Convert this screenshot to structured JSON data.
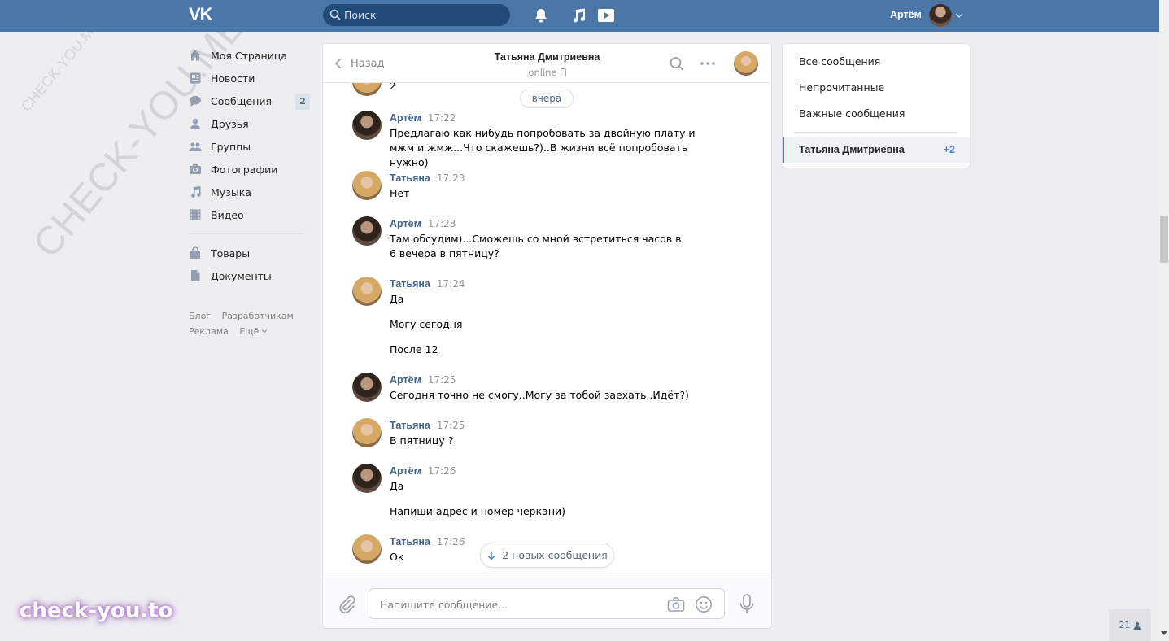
{
  "header": {
    "logo_text": "VK",
    "search_placeholder": "Поиск",
    "user_name": "Артём"
  },
  "sidebar": {
    "items": [
      {
        "label": "Моя Страница",
        "icon": "home-icon"
      },
      {
        "label": "Новости",
        "icon": "news-icon"
      },
      {
        "label": "Сообщения",
        "icon": "messages-icon",
        "badge": "2"
      },
      {
        "label": "Друзья",
        "icon": "friend-icon"
      },
      {
        "label": "Группы",
        "icon": "groups-icon"
      },
      {
        "label": "Фотографии",
        "icon": "camera-icon"
      },
      {
        "label": "Музыка",
        "icon": "music-icon"
      },
      {
        "label": "Видео",
        "icon": "video-icon"
      },
      {
        "label": "Товары",
        "icon": "bag-icon"
      },
      {
        "label": "Документы",
        "icon": "document-icon"
      }
    ],
    "footer": {
      "blog": "Блог",
      "developers": "Разработчикам",
      "ads": "Реклама",
      "more": "Ещё"
    }
  },
  "chat": {
    "back_label": "Назад",
    "peer_name": "Татьяна Дмитриевна",
    "peer_status": "online",
    "previous_text": "2",
    "date_divider": "вчера",
    "messages": [
      {
        "author": "Артём",
        "time": "17:22",
        "lines": [
          "Предлагаю как нибудь попробовать за двойную плату и мжм и жмж...Что скажешь?)..В жизни всё попробовать нужно)"
        ]
      },
      {
        "author": "Татьяна",
        "time": "17:23",
        "lines": [
          "Нет"
        ]
      },
      {
        "author": "Артём",
        "time": "17:23",
        "lines": [
          "Там обсудим)...Сможешь со мной встретиться часов в 6 вечера в пятницу?"
        ]
      },
      {
        "author": "Татьяна",
        "time": "17:24",
        "lines": [
          "Да",
          "Могу сегодня",
          "После 12"
        ]
      },
      {
        "author": "Артём",
        "time": "17:25",
        "lines": [
          "Сегодня точно не смогу..Могу за тобой заехать..Идёт?)"
        ]
      },
      {
        "author": "Татьяна",
        "time": "17:25",
        "lines": [
          "В пятницу ?"
        ]
      },
      {
        "author": "Артём",
        "time": "17:26",
        "lines": [
          "Да",
          "Напиши адрес и номер черкани)"
        ]
      },
      {
        "author": "Татьяна",
        "time": "17:26",
        "lines": [
          "Ок"
        ]
      }
    ],
    "new_messages_label": "2 новых сообщения",
    "input_placeholder": "Напишите сообщение..."
  },
  "right_panel": {
    "all": "Все сообщения",
    "unread": "Непрочитанные",
    "important": "Важные сообщения",
    "active_dialog": "Татьяна Дмитриевна",
    "active_count": "+2"
  },
  "watermarks": {
    "big": "CHECK-YOU.ME",
    "small": "CHECK-YOU.ME",
    "brand": "check-you.to"
  },
  "online_widget": {
    "count": "21"
  },
  "colors": {
    "header_bg": "#4a76a8",
    "link": "#42648b",
    "page_bg": "#edeef0",
    "accent": "#5181b8"
  }
}
